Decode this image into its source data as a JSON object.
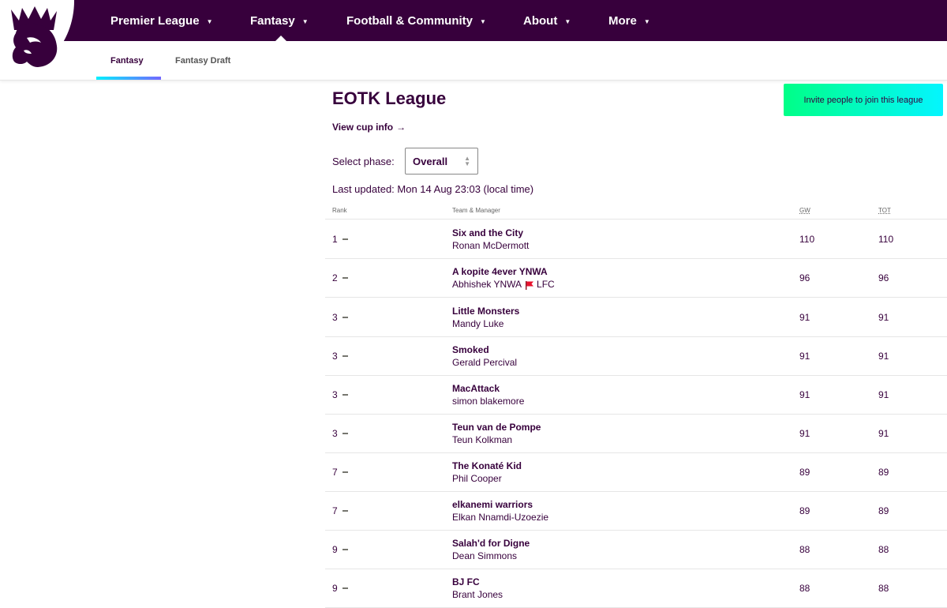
{
  "nav": {
    "items": [
      {
        "label": "Premier League"
      },
      {
        "label": "Fantasy"
      },
      {
        "label": "Football & Community"
      },
      {
        "label": "About"
      },
      {
        "label": "More"
      }
    ]
  },
  "subnav": {
    "items": [
      {
        "label": "Fantasy"
      },
      {
        "label": "Fantasy Draft"
      }
    ]
  },
  "league": {
    "title": "EOTK League",
    "invite_label": "Invite people to join this league",
    "cup_link": "View cup info",
    "cup_arrow": "→",
    "phase_label": "Select phase:",
    "phase_value": "Overall",
    "last_updated": "Last updated: Mon 14 Aug 23:03 (local time)"
  },
  "table": {
    "headers": {
      "rank": "Rank",
      "team": "Team & Manager",
      "gw": "GW",
      "tot": "TOT"
    },
    "rows": [
      {
        "rank": "1",
        "team": "Six and the City",
        "manager": "Ronan McDermott",
        "gw": "110",
        "tot": "110"
      },
      {
        "rank": "2",
        "team": "A kopite 4ever YNWA",
        "manager": "Abhishek YNWA",
        "manager_suffix": "LFC",
        "gw": "96",
        "tot": "96"
      },
      {
        "rank": "3",
        "team": "Little Monsters",
        "manager": "Mandy Luke",
        "gw": "91",
        "tot": "91"
      },
      {
        "rank": "3",
        "team": "Smoked",
        "manager": "Gerald Percival",
        "gw": "91",
        "tot": "91"
      },
      {
        "rank": "3",
        "team": "MacAttack",
        "manager": "simon blakemore",
        "gw": "91",
        "tot": "91"
      },
      {
        "rank": "3",
        "team": "Teun van de Pompe",
        "manager": "Teun Kolkman",
        "gw": "91",
        "tot": "91"
      },
      {
        "rank": "7",
        "team": "The Konaté Kid",
        "manager": "Phil Cooper",
        "gw": "89",
        "tot": "89"
      },
      {
        "rank": "7",
        "team": "elkanemi warriors",
        "manager": "Elkan Nnamdi-Uzoezie",
        "gw": "89",
        "tot": "89"
      },
      {
        "rank": "9",
        "team": "Salah'd for Digne",
        "manager": "Dean Simmons",
        "gw": "88",
        "tot": "88"
      },
      {
        "rank": "9",
        "team": "BJ FC",
        "manager": "Brant Jones",
        "gw": "88",
        "tot": "88"
      }
    ]
  },
  "colors": {
    "brand": "#37003c",
    "accent_green": "#00ff87",
    "accent_cyan": "#04f5ff",
    "flag_red": "#e8112d"
  }
}
